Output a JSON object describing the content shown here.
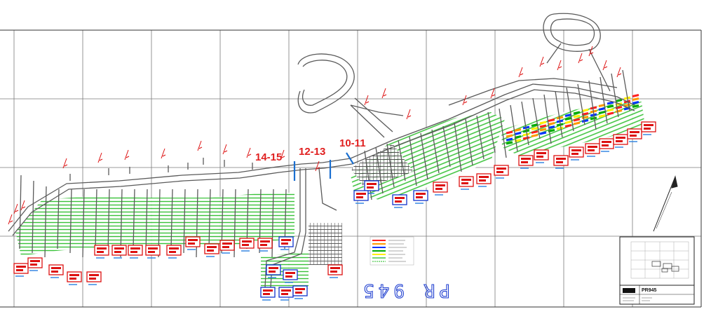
{
  "section_labels": {
    "s1415": "14-15",
    "s1213": "12-13",
    "s1011": "10-11"
  },
  "plan_label": "PR 945",
  "title_block": {
    "drawing_no": "PR945"
  },
  "colors": {
    "drift": "#5a5a5a",
    "grid": "#7a7a7a",
    "hatch_green": "#22bb22",
    "hatch_grey": "#444444",
    "tag_red": "#dd1111",
    "tag_blue": "#1133cc",
    "section_marker": "#1a6fd0",
    "legend": [
      "#ff2020",
      "#ff9900",
      "#0033ff",
      "#00aa00",
      "#ffee00"
    ]
  },
  "icons": {
    "north_arrow": "north-arrow-icon"
  }
}
